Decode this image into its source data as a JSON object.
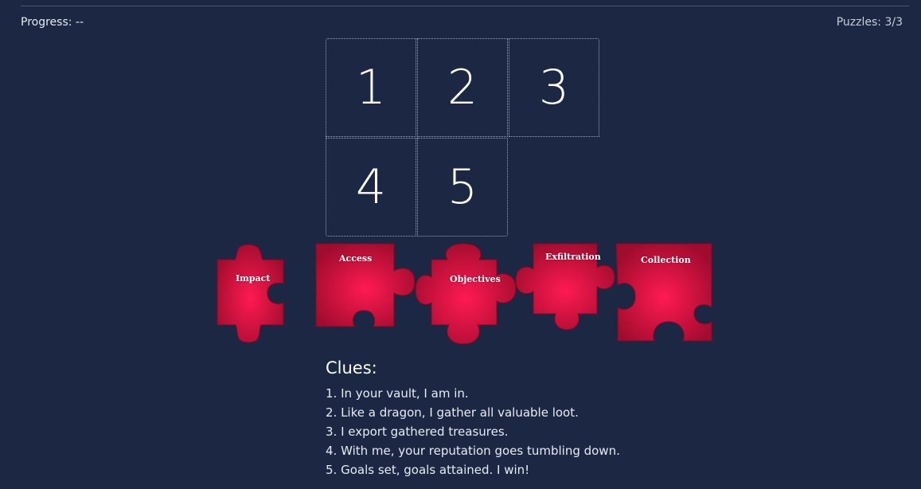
{
  "header": {
    "progress": "Progress: --",
    "puzzles": "Puzzles: 3/3"
  },
  "grid": {
    "cells": [
      "1",
      "2",
      "3",
      "4",
      "5"
    ]
  },
  "pieces": [
    {
      "label": "Impact"
    },
    {
      "label": "Access"
    },
    {
      "label": "Objectives"
    },
    {
      "label": "Exfiltration"
    },
    {
      "label": "Collection"
    }
  ],
  "clues": {
    "title": "Clues:",
    "items": [
      "1. In your vault, I am in.",
      "2. Like a dragon, I gather all valuable loot.",
      "3. I export gathered treasures.",
      "4. With me, your reputation goes tumbling down.",
      "5. Goals set, goals attained. I win!"
    ]
  },
  "colors": {
    "background": "#1b2743",
    "piece_center": "#ff1a52",
    "piece_edge": "#a00c2e"
  }
}
